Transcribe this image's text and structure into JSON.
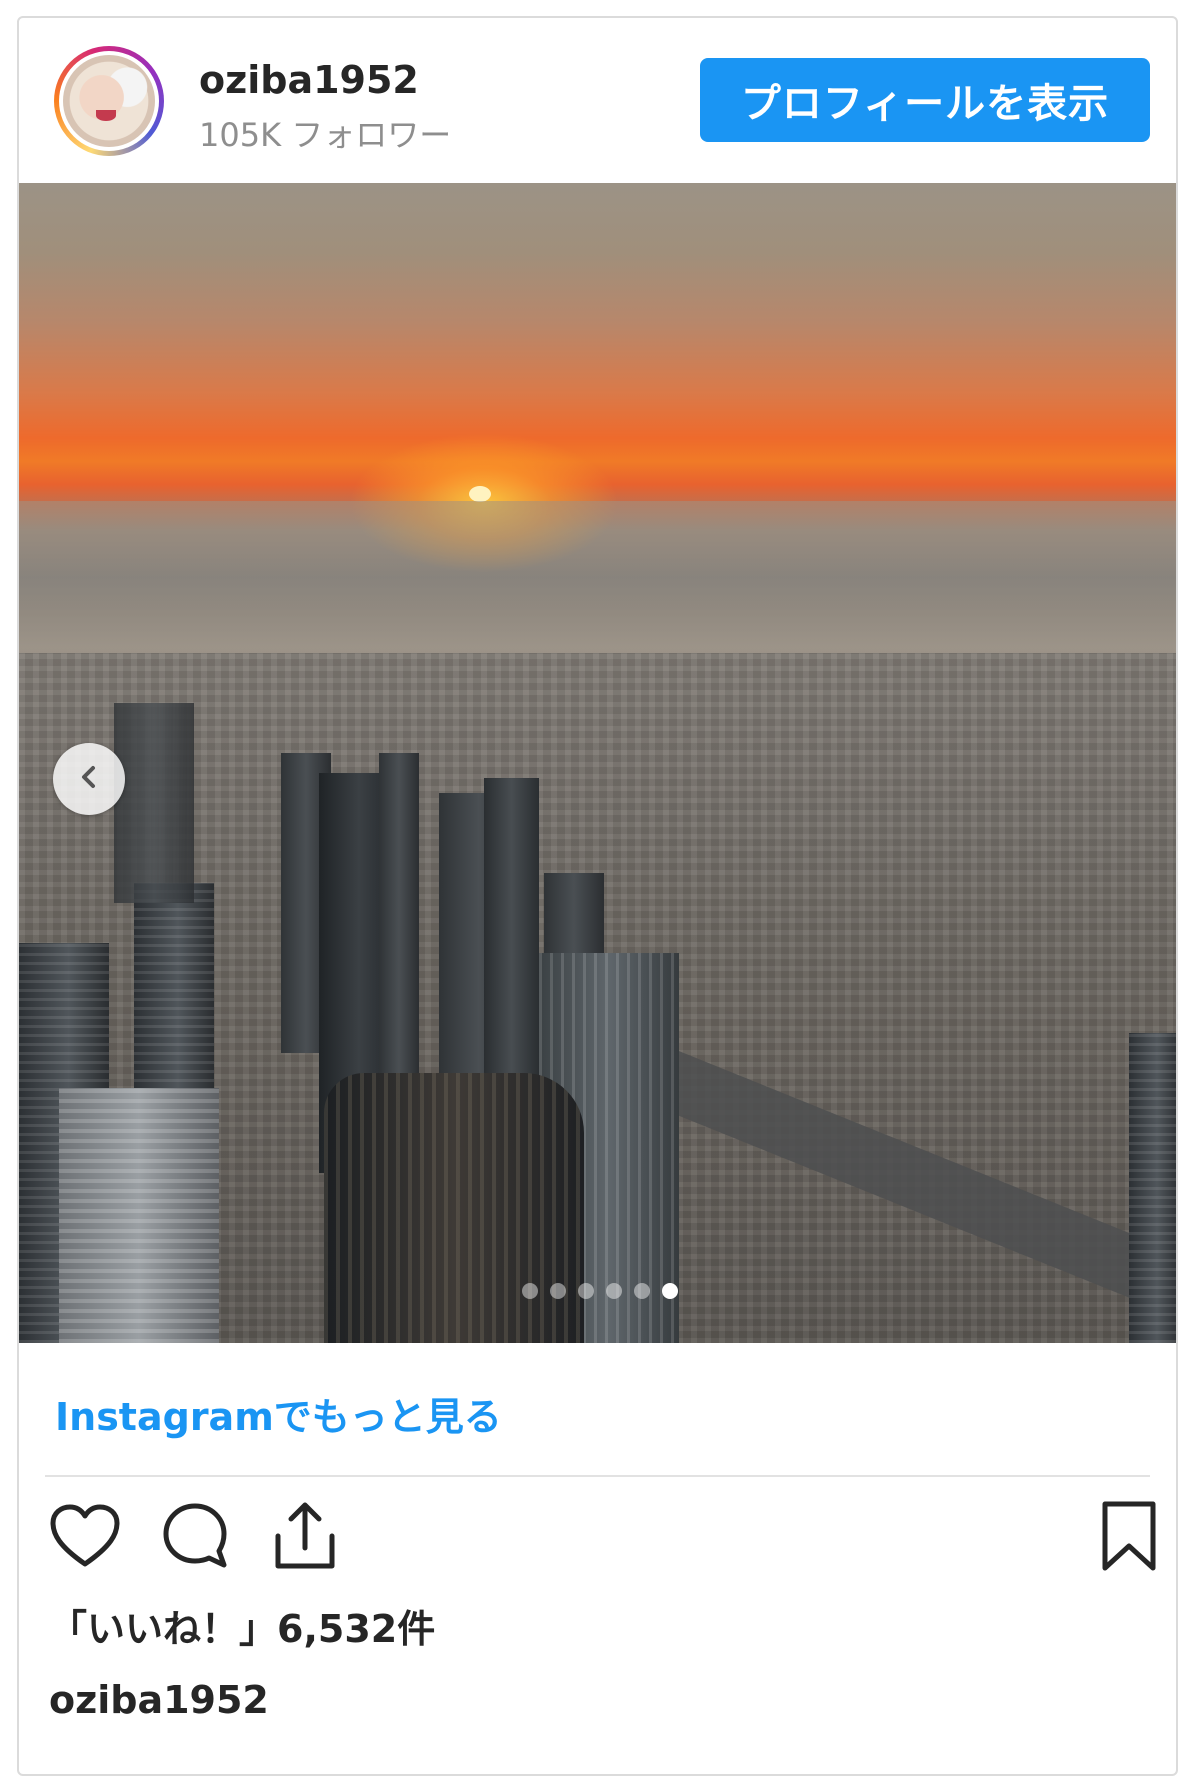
{
  "header": {
    "username": "oziba1952",
    "followers": "105K フォロワー",
    "profile_button": "プロフィールを表示",
    "avatar_icon": "user-avatar"
  },
  "carousel": {
    "slide_count": 6,
    "active_slide": 6,
    "prev_icon": "chevron-left-icon"
  },
  "footer": {
    "more_link": "Instagramでもっと見る",
    "likes": "「いいね！」6,532件",
    "caption_user": "oziba1952"
  },
  "icons": {
    "like": "heart-icon",
    "comment": "comment-icon",
    "share": "share-icon",
    "save": "bookmark-icon"
  },
  "colors": {
    "accent": "#1a95f3",
    "text": "#262626",
    "muted": "#8e8e8e",
    "border": "#dbdbdb"
  }
}
